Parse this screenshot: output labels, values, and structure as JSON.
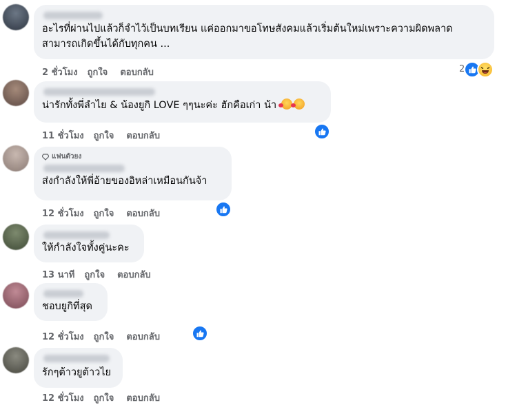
{
  "comments": [
    {
      "text": "อะไรที่ผ่านไปแล้วก็จำไว้เป็นบทเรียน แค่ออกมาขอโทษสังคมแล้วเริ่มต้นใหม่เพราะความผิดพลาดสามารถเกิดขึ้นได้กับทุกคน ...",
      "time": "2 ชั่วโมง",
      "like": "ถูกใจ",
      "reply": "ตอบกลับ",
      "reaction_count": "2",
      "reactions": [
        "like-icon",
        "haha-icon"
      ]
    },
    {
      "text": "น่ารักทั้งพี่ลำไย & น้องยูกิ LOVE ๆๆนะค่ะ ฮักคือเก่า น้า",
      "time": "11 ชั่วโมง",
      "like": "ถูกใจ",
      "reply": "ตอบกลับ",
      "reactions": [
        "like-icon"
      ],
      "emoji": [
        "smiling-face-with-hearts-icon",
        "smiling-face-with-hearts-icon"
      ]
    },
    {
      "badge": "แฟนตัวยง",
      "text": "ส่งกำลังให้พี่อ้ายของอิหล่าเหมือนกันจ้า",
      "time": "12 ชั่วโมง",
      "like": "ถูกใจ",
      "reply": "ตอบกลับ",
      "reactions": [
        "like-icon"
      ]
    },
    {
      "text": "ให้กำลังใจทั้งคู่นะคะ",
      "time": "13 นาที",
      "like": "ถูกใจ",
      "reply": "ตอบกลับ"
    },
    {
      "text": "ชอบยูกิที่สุด",
      "time": "12 ชั่วโมง",
      "like": "ถูกใจ",
      "reply": "ตอบกลับ",
      "reactions": [
        "like-icon"
      ]
    },
    {
      "text": "รักๆต้าวยูต้าวไย",
      "time": "12 ชั่วโมง",
      "like": "ถูกใจ",
      "reply": "ตอบกลับ"
    }
  ],
  "colors": {
    "bubble": "#f0f2f5",
    "meta_text": "#65676b",
    "like_blue": "#1877f2"
  }
}
